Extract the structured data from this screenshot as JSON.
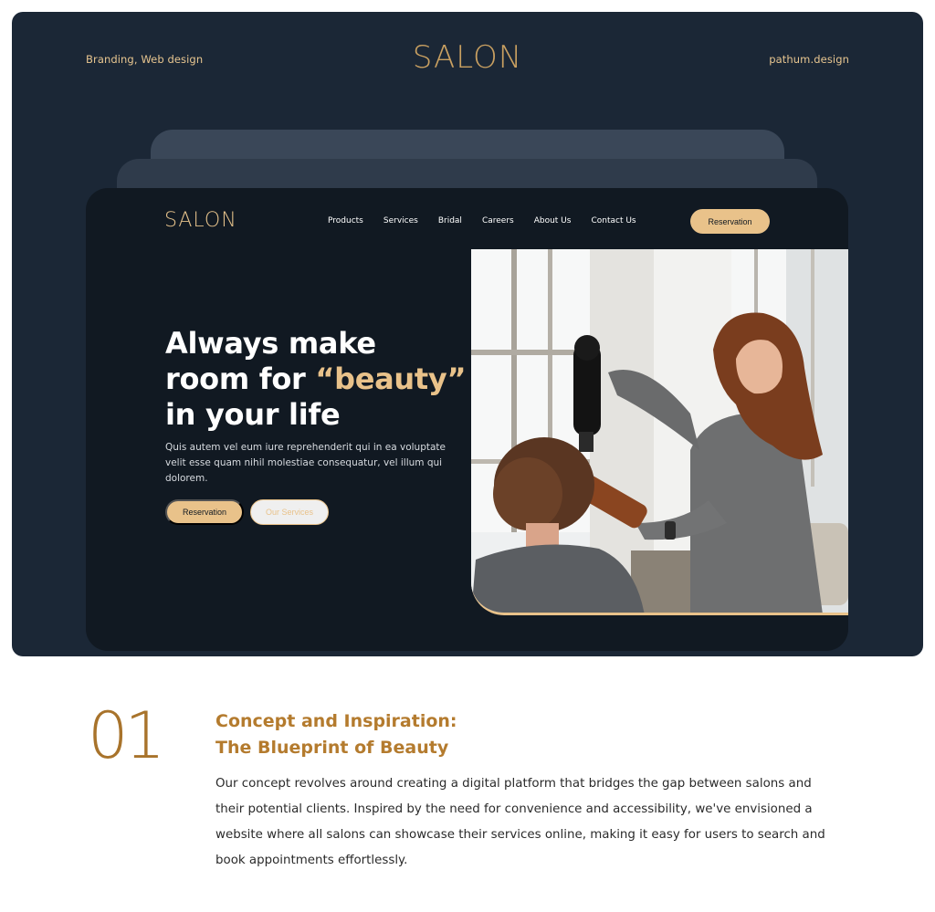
{
  "showcase": {
    "meta_left": "Branding, Web design",
    "meta_right": "pathum.design",
    "logo_text": "SALON"
  },
  "site": {
    "logo_text": "SALON",
    "nav": [
      {
        "label": "Products"
      },
      {
        "label": "Services"
      },
      {
        "label": "Bridal"
      },
      {
        "label": "Careers"
      },
      {
        "label": "About Us"
      },
      {
        "label": "Contact Us"
      }
    ],
    "nav_cta": "Reservation",
    "hero": {
      "title_line1": "Always make",
      "title_line2_pre": "room for ",
      "title_accent": "“beauty”",
      "title_line3": "in your life",
      "description": "Quis autem vel eum iure reprehenderit qui in ea voluptate velit esse quam nihil molestiae consequatur, vel illum qui dolorem.",
      "primary_button": "Reservation",
      "secondary_button": "Our Services"
    }
  },
  "section": {
    "number": "01",
    "heading_line1": "Concept and Inspiration:",
    "heading_line2": "The Blueprint of Beauty",
    "body": "Our concept revolves around creating a digital platform that bridges the gap between salons and their potential clients. Inspired by the need for convenience and accessibility, we've envisioned a website where all salons can showcase their services online, making it easy for users to search and book appointments effortlessly."
  },
  "colors": {
    "showcase_bg": "#1b2736",
    "site_bg": "#111922",
    "accent": "#e9c28a",
    "section_accent": "#b47b2e"
  }
}
